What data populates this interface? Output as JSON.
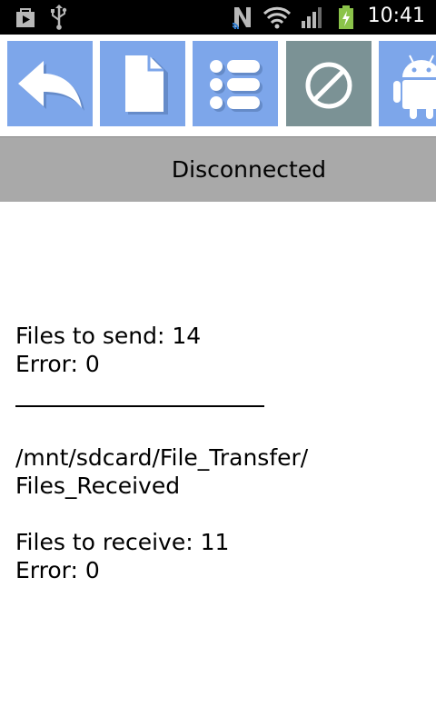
{
  "status_bar": {
    "time": "10:41",
    "icons": [
      "play-store-icon",
      "usb-icon",
      "nfc-icon",
      "wifi-icon",
      "signal-icon",
      "battery-charging-icon"
    ]
  },
  "toolbar": {
    "buttons": [
      {
        "name": "back",
        "icon": "reply-arrow-icon"
      },
      {
        "name": "file",
        "icon": "document-icon"
      },
      {
        "name": "list",
        "icon": "list-icon"
      },
      {
        "name": "disconnect",
        "icon": "prohibited-icon"
      },
      {
        "name": "android",
        "icon": "android-icon"
      }
    ],
    "colors": {
      "button": "#7da6ea",
      "disabled": "#7b9295"
    }
  },
  "connection": {
    "status": "Disconnected",
    "background": "#a9a9a9"
  },
  "send": {
    "files_label": "Files to send: 14",
    "error_label": "Error: 0"
  },
  "receive": {
    "path_line1": "/mnt/sdcard/File_Transfer/",
    "path_line2": "Files_Received",
    "files_label": "Files to receive: 11",
    "error_label": "Error: 0"
  }
}
